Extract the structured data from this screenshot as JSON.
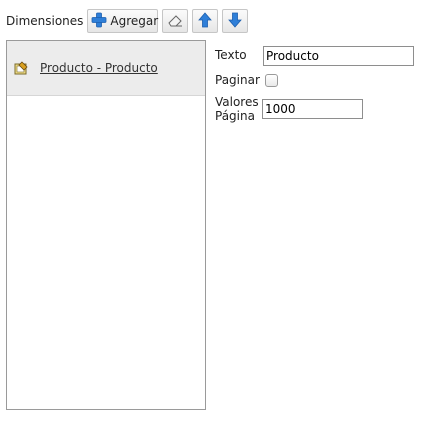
{
  "toolbar": {
    "label": "Dimensiones",
    "add_label": "Agregar",
    "icons": {
      "add": "plus-icon",
      "clear": "eraser-icon",
      "move_up": "arrow-up-icon",
      "move_down": "arrow-down-icon"
    }
  },
  "list": {
    "items": [
      {
        "label": "Producto - Producto",
        "icon": "dimension-icon",
        "selected": true
      }
    ]
  },
  "properties": {
    "texto_label": "Texto",
    "texto_value": "Producto",
    "paginar_label": "Paginar",
    "paginar_checked": false,
    "valores_label_line1": "Valores",
    "valores_label_line2": "Página",
    "valores_value": "1000"
  },
  "colors": {
    "accent_blue": "#2f7fd8",
    "selected_row": "#ececec"
  }
}
